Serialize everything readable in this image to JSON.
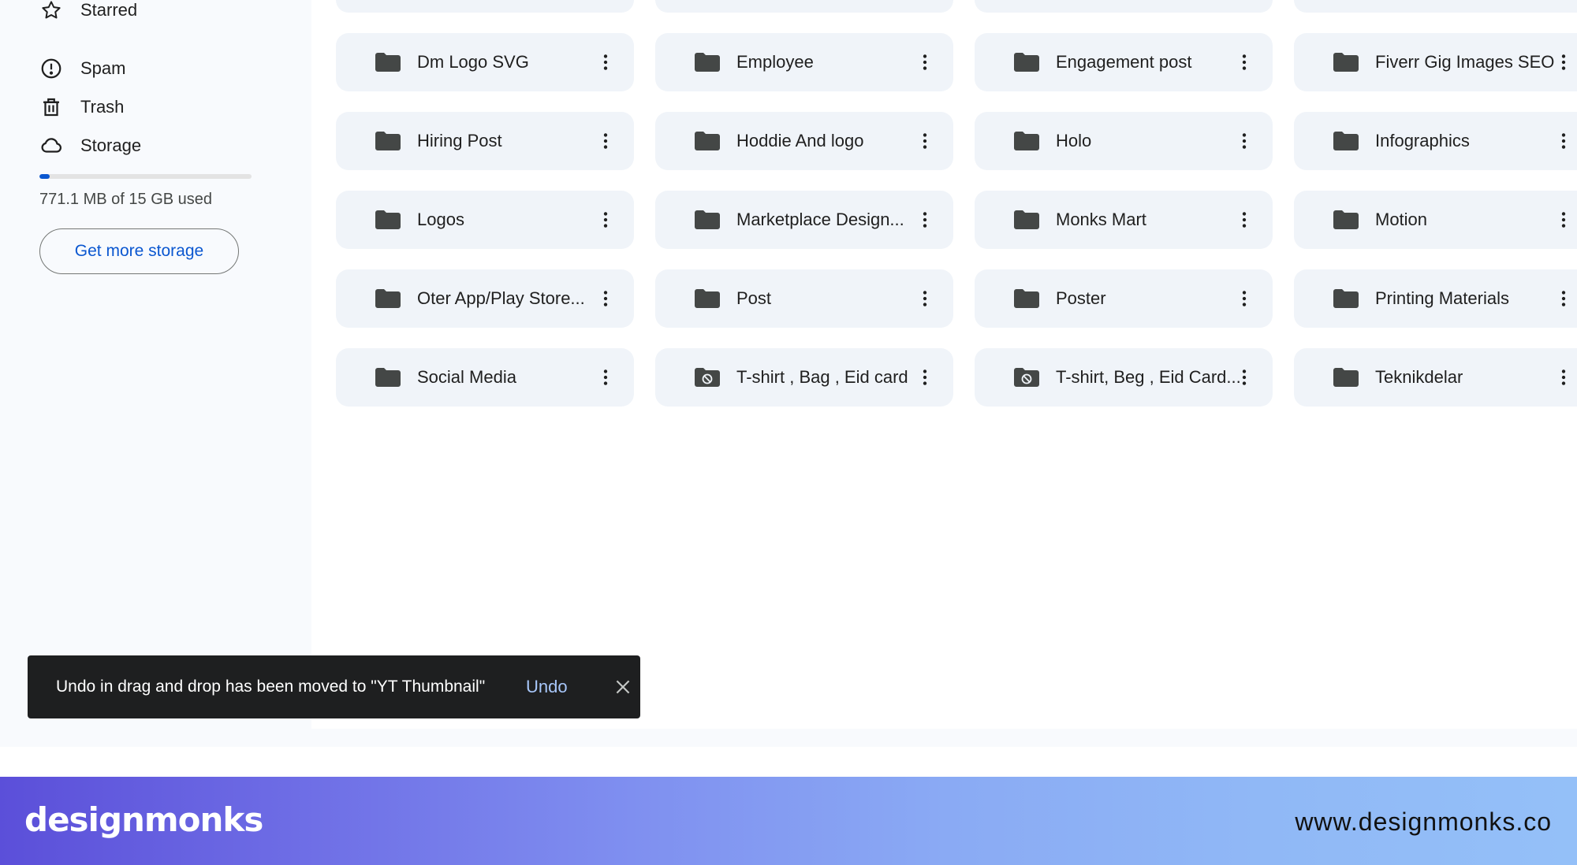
{
  "sidebar": {
    "items": [
      {
        "label": "Starred",
        "icon": "star-icon"
      },
      {
        "label": "Spam",
        "icon": "spam-icon"
      },
      {
        "label": "Trash",
        "icon": "trash-icon"
      },
      {
        "label": "Storage",
        "icon": "cloud-icon"
      }
    ],
    "storage": {
      "used_text": "771.1 MB of 15 GB used",
      "used_fraction": 0.05,
      "get_more_label": "Get more storage"
    }
  },
  "folders": [
    {
      "name": "Dm Logo SVG",
      "shared": false
    },
    {
      "name": "Employee",
      "shared": false
    },
    {
      "name": "Engagement post",
      "shared": false
    },
    {
      "name": "Fiverr Gig Images SEO",
      "shared": false
    },
    {
      "name": "Hiring Post",
      "shared": false
    },
    {
      "name": "Hoddie And logo",
      "shared": false
    },
    {
      "name": "Holo",
      "shared": false
    },
    {
      "name": "Infographics",
      "shared": false
    },
    {
      "name": "Logos",
      "shared": false
    },
    {
      "name": "Marketplace Design...",
      "shared": false
    },
    {
      "name": "Monks Mart",
      "shared": false
    },
    {
      "name": "Motion",
      "shared": false
    },
    {
      "name": "Oter App/Play Store...",
      "shared": false
    },
    {
      "name": "Post",
      "shared": false
    },
    {
      "name": "Poster",
      "shared": false
    },
    {
      "name": "Printing Materials",
      "shared": false
    },
    {
      "name": "Social Media",
      "shared": false
    },
    {
      "name": "T-shirt , Bag , Eid card",
      "shared": true
    },
    {
      "name": "T-shirt, Beg , Eid Card...",
      "shared": true
    },
    {
      "name": "Teknikdelar",
      "shared": false
    }
  ],
  "toast": {
    "message": "Undo in drag and drop has been moved to \"YT Thumbnail\"",
    "undo_label": "Undo"
  },
  "banner": {
    "logo": "designmonks",
    "url": "www.designmonks.co"
  },
  "colors": {
    "accent": "#0b57d0",
    "card_bg": "#f0f4f9",
    "toast_bg": "#1e1f20",
    "undo_link": "#a8c7fa"
  }
}
